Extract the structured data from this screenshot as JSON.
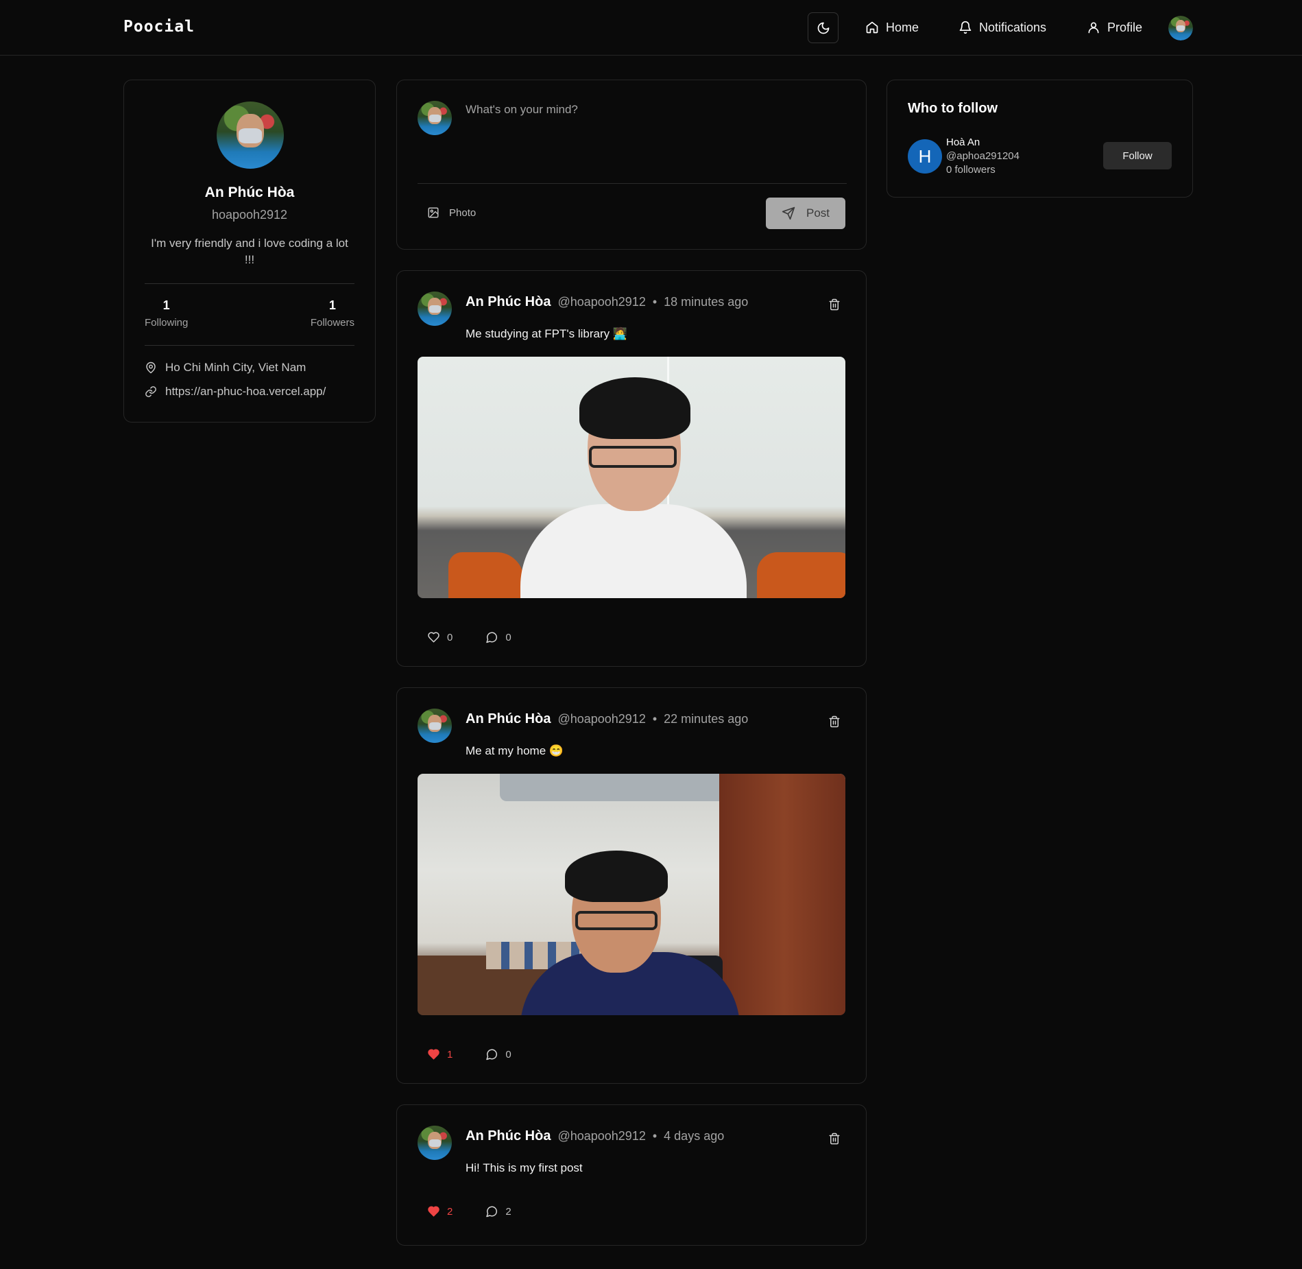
{
  "app": {
    "logo": "Poocial"
  },
  "nav": {
    "home": "Home",
    "notifications": "Notifications",
    "profile": "Profile"
  },
  "profile": {
    "name": "An Phúc Hòa",
    "username": "hoapooh2912",
    "bio": "I'm very friendly and i love coding a lot !!!",
    "following_count": "1",
    "following_label": "Following",
    "followers_count": "1",
    "followers_label": "Followers",
    "location": "Ho Chi Minh City, Viet Nam",
    "website": "https://an-phuc-hoa.vercel.app/"
  },
  "composer": {
    "placeholder": "What's on your mind?",
    "photo_label": "Photo",
    "post_label": "Post"
  },
  "posts": [
    {
      "author": "An Phúc Hòa",
      "handle": "@hoapooh2912",
      "separator": "•",
      "time": "18 minutes ago",
      "text": "Me studying at FPT's library 🧑‍💻",
      "likes": "0",
      "comments": "0",
      "liked": false
    },
    {
      "author": "An Phúc Hòa",
      "handle": "@hoapooh2912",
      "separator": "•",
      "time": "22 minutes ago",
      "text": "Me at my home 😁",
      "likes": "1",
      "comments": "0",
      "liked": true
    },
    {
      "author": "An Phúc Hòa",
      "handle": "@hoapooh2912",
      "separator": "•",
      "time": "4 days ago",
      "text": "Hi! This is my first post",
      "likes": "2",
      "comments": "2",
      "liked": true
    }
  ],
  "who_to_follow": {
    "title": "Who to follow",
    "users": [
      {
        "initial": "H",
        "name": "Hoà An",
        "handle": "@aphoa291204",
        "followers": "0 followers",
        "button": "Follow"
      }
    ]
  },
  "icons": {
    "theme": "moon-icon",
    "home": "house-icon",
    "notifications": "bell-icon",
    "profile": "user-icon",
    "location": "map-pin-icon",
    "website": "link-icon",
    "photo": "image-icon",
    "post": "send-icon",
    "delete": "trash-icon",
    "like": "heart-icon",
    "comment": "message-circle-icon"
  },
  "colors": {
    "background": "#0a0a0a",
    "border": "#262626",
    "liked": "#ef4444",
    "follow_avatar": "#1466b8"
  }
}
